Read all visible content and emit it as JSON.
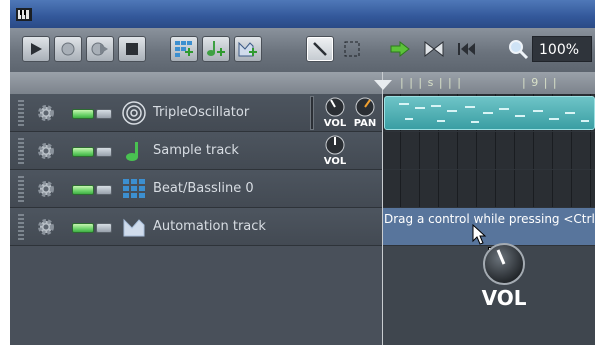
{
  "toolbar": {
    "buttons": [
      {
        "name": "play-button",
        "icon": "play-icon"
      },
      {
        "name": "record-button",
        "icon": "record-icon"
      },
      {
        "name": "record-while-playing-button",
        "icon": "record-play-icon"
      },
      {
        "name": "stop-button",
        "icon": "stop-icon"
      },
      {
        "name": "add-beat-bassline-button",
        "icon": "beat-add-icon"
      },
      {
        "name": "add-sample-track-button",
        "icon": "sample-add-icon"
      },
      {
        "name": "add-automation-track-button",
        "icon": "automation-add-icon"
      },
      {
        "name": "draw-mode-button",
        "icon": "pencil-icon"
      },
      {
        "name": "edit-mode-button",
        "icon": "select-icon"
      },
      {
        "name": "auto-scroll-button",
        "icon": "arrow-right-icon"
      },
      {
        "name": "loop-points-button",
        "icon": "loop-icon"
      },
      {
        "name": "stop-behavior-button",
        "icon": "back-to-start-icon"
      }
    ],
    "zoom_value": "100%"
  },
  "ruler": {
    "text_a": "| |  | s |  |  |",
    "text_b": "| 9 |  |"
  },
  "tracks": [
    {
      "name": "TripleOscillator",
      "type": "instrument",
      "icon": "triple-oscillator-icon",
      "knobs": [
        "VOL",
        "PAN"
      ]
    },
    {
      "name": "Sample track",
      "type": "sample",
      "icon": "note-icon",
      "knobs": [
        "VOL"
      ]
    },
    {
      "name": "Beat/Bassline 0",
      "type": "beat",
      "icon": "beat-grid-icon",
      "knobs": []
    },
    {
      "name": "Automation track",
      "type": "automation",
      "icon": "automation-icon",
      "knobs": [],
      "lane_text": "Drag a control while pressing <Ctrl>"
    }
  ],
  "drag_label": "VOL",
  "colors": {
    "titlebar": "#3a5f9e",
    "track_bg": "#4d555f",
    "pattern": "#4fb2b6",
    "automation_lane": "#58759c",
    "led_on": "#6cd36a"
  }
}
